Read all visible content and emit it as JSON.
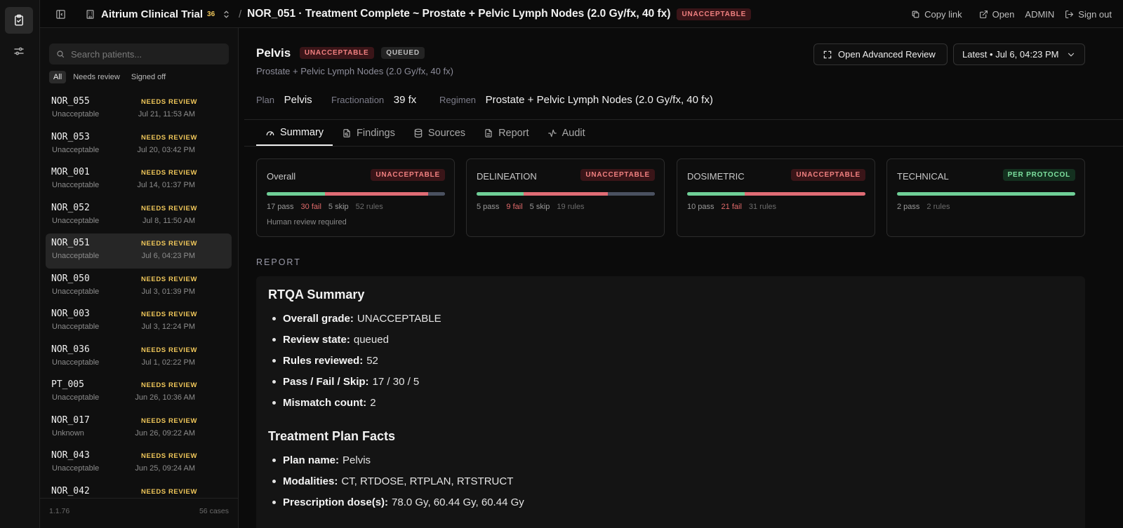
{
  "project": {
    "name": "Aitrium Clinical Trial",
    "count": "36"
  },
  "breadcrumb": {
    "title": "NOR_051 · Treatment Complete ~ Prostate + Pelvic Lymph Nodes (2.0 Gy/fx, 40 fx)",
    "badge": "UNACCEPTABLE",
    "separator": "/"
  },
  "topbar": {
    "copy_link": "Copy link",
    "open": "Open",
    "user": "ADMIN",
    "sign_out": "Sign out"
  },
  "search": {
    "placeholder": "Search patients..."
  },
  "filters": [
    "All",
    "Needs review",
    "Signed off"
  ],
  "patients": [
    {
      "id": "NOR_055",
      "state": "Unacceptable",
      "badge": "NEEDS REVIEW",
      "time": "Jul 21, 11:53 AM"
    },
    {
      "id": "NOR_053",
      "state": "Unacceptable",
      "badge": "NEEDS REVIEW",
      "time": "Jul 20, 03:42 PM"
    },
    {
      "id": "MOR_001",
      "state": "Unacceptable",
      "badge": "NEEDS REVIEW",
      "time": "Jul 14, 01:37 PM"
    },
    {
      "id": "NOR_052",
      "state": "Unacceptable",
      "badge": "NEEDS REVIEW",
      "time": "Jul 8, 11:50 AM"
    },
    {
      "id": "NOR_051",
      "state": "Unacceptable",
      "badge": "NEEDS REVIEW",
      "time": "Jul 6, 04:23 PM"
    },
    {
      "id": "NOR_050",
      "state": "Unacceptable",
      "badge": "NEEDS REVIEW",
      "time": "Jul 3, 01:39 PM"
    },
    {
      "id": "NOR_003",
      "state": "Unacceptable",
      "badge": "NEEDS REVIEW",
      "time": "Jul 3, 12:24 PM"
    },
    {
      "id": "NOR_036",
      "state": "Unacceptable",
      "badge": "NEEDS REVIEW",
      "time": "Jul 1, 02:22 PM"
    },
    {
      "id": "PT_005",
      "state": "Unacceptable",
      "badge": "NEEDS REVIEW",
      "time": "Jun 26, 10:36 AM"
    },
    {
      "id": "NOR_017",
      "state": "Unknown",
      "badge": "NEEDS REVIEW",
      "time": "Jun 26, 09:22 AM"
    },
    {
      "id": "NOR_043",
      "state": "Unacceptable",
      "badge": "NEEDS REVIEW",
      "time": "Jun 25, 09:24 AM"
    },
    {
      "id": "NOR_042",
      "state": "",
      "badge": "NEEDS REVIEW",
      "time": ""
    }
  ],
  "sidebar_footer": {
    "version": "1.1.76",
    "cases": "56 cases"
  },
  "header": {
    "title": "Pelvis",
    "badge_grade": "UNACCEPTABLE",
    "badge_state": "QUEUED",
    "subtitle": "Prostate + Pelvic Lymph Nodes (2.0 Gy/fx, 40 fx)",
    "advanced_review": "Open Advanced Review",
    "version_select": "Latest • Jul 6, 04:23 PM"
  },
  "meta": {
    "plan_label": "Plan",
    "plan_value": "Pelvis",
    "fractionation_label": "Fractionation",
    "fractionation_value": "39 fx",
    "regimen_label": "Regimen",
    "regimen_value": "Prostate + Pelvic Lymph Nodes (2.0 Gy/fx, 40 fx)"
  },
  "tabs": [
    "Summary",
    "Findings",
    "Sources",
    "Report",
    "Audit"
  ],
  "cards": [
    {
      "title": "Overall",
      "badge": "UNACCEPTABLE",
      "pass": "17 pass",
      "fail": "30 fail",
      "skip": "5 skip",
      "rules": "52 rules",
      "note": "Human review required",
      "counts": [
        17,
        30,
        5
      ]
    },
    {
      "title": "DELINEATION",
      "badge": "UNACCEPTABLE",
      "pass": "5 pass",
      "fail": "9 fail",
      "skip": "5 skip",
      "rules": "19 rules",
      "note": "",
      "counts": [
        5,
        9,
        5
      ]
    },
    {
      "title": "DOSIMETRIC",
      "badge": "UNACCEPTABLE",
      "pass": "10 pass",
      "fail": "21 fail",
      "skip": "",
      "rules": "31 rules",
      "note": "",
      "counts": [
        10,
        21,
        0
      ]
    },
    {
      "title": "TECHNICAL",
      "badge": "PER PROTOCOL",
      "pass": "2 pass",
      "fail": "",
      "skip": "",
      "rules": "2 rules",
      "note": "",
      "counts": [
        2,
        0,
        0
      ]
    }
  ],
  "colors": {
    "pass": "#6fcf97",
    "fail": "#e06c75",
    "skip": "#4a5160",
    "needs_review": "#f0c75a"
  },
  "report": {
    "label": "REPORT",
    "summary_heading": "RTQA Summary",
    "summary_items": [
      {
        "k": "Overall grade:",
        "v": "UNACCEPTABLE"
      },
      {
        "k": "Review state:",
        "v": "queued"
      },
      {
        "k": "Rules reviewed:",
        "v": "52"
      },
      {
        "k": "Pass / Fail / Skip:",
        "v": "17 / 30 / 5"
      },
      {
        "k": "Mismatch count:",
        "v": "2"
      }
    ],
    "facts_heading": "Treatment Plan Facts",
    "facts_items": [
      {
        "k": "Plan name:",
        "v": "Pelvis"
      },
      {
        "k": "Modalities:",
        "v": "CT, RTDOSE, RTPLAN, RTSTRUCT"
      },
      {
        "k": "Prescription dose(s):",
        "v": "78.0 Gy, 60.44 Gy, 60.44 Gy"
      }
    ]
  }
}
